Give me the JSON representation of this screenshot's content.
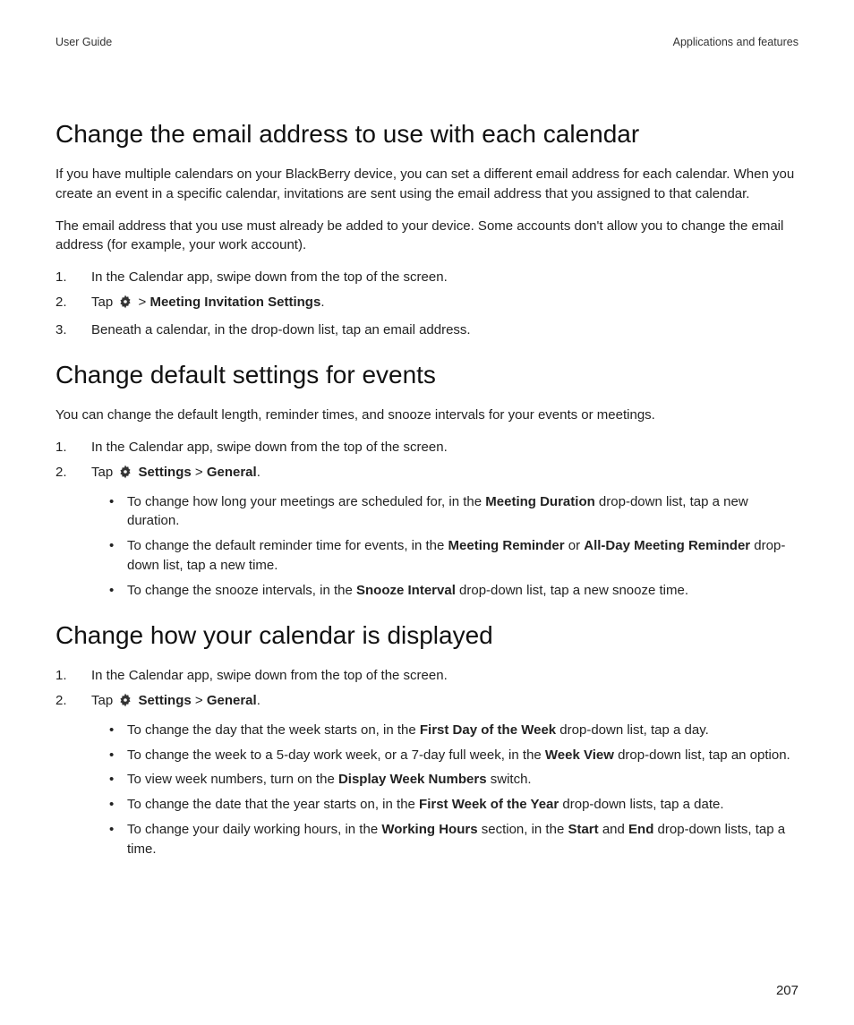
{
  "header": {
    "left": "User Guide",
    "right": "Applications and features"
  },
  "page_number": "207",
  "sec1": {
    "title": "Change the email address to use with each calendar",
    "p1": "If you have multiple calendars on your BlackBerry device, you can set a different email address for each calendar. When you create an event in a specific calendar, invitations are sent using the email address that you assigned to that calendar.",
    "p2": "The email address that you use must already be added to your device. Some accounts don't allow you to change the email address (for example, your work account).",
    "step1": "In the Calendar app, swipe down from the top of the screen.",
    "step2_pre": "Tap ",
    "step2_mid": "  > ",
    "step2_bold": "Meeting Invitation Settings",
    "step2_post": ".",
    "step3": "Beneath a calendar, in the drop-down list, tap an email address."
  },
  "sec2": {
    "title": "Change default settings for events",
    "p1": "You can change the default length, reminder times, and snooze intervals for your events or meetings.",
    "step1": "In the Calendar app, swipe down from the top of the screen.",
    "step2_pre": "Tap ",
    "step2_b1": " Settings",
    "step2_sep": " > ",
    "step2_b2": "General",
    "step2_post": ".",
    "b1_a": "To change how long your meetings are scheduled for, in the ",
    "b1_b": "Meeting Duration",
    "b1_c": " drop-down list, tap a new duration.",
    "b2_a": "To change the default reminder time for events, in the ",
    "b2_b": "Meeting Reminder",
    "b2_c": " or ",
    "b2_d": "All-Day Meeting Reminder",
    "b2_e": " drop-down list, tap a new time.",
    "b3_a": "To change the snooze intervals, in the ",
    "b3_b": "Snooze Interval",
    "b3_c": " drop-down list, tap a new snooze time."
  },
  "sec3": {
    "title": "Change how your calendar is displayed",
    "step1": "In the Calendar app, swipe down from the top of the screen.",
    "step2_pre": "Tap ",
    "step2_b1": " Settings",
    "step2_sep": " > ",
    "step2_b2": "General",
    "step2_post": ".",
    "b1_a": "To change the day that the week starts on, in the ",
    "b1_b": "First Day of the Week",
    "b1_c": " drop-down list, tap a day.",
    "b2_a": "To change the week to a 5-day work week, or a 7-day full week, in the ",
    "b2_b": "Week View",
    "b2_c": " drop-down list, tap an option.",
    "b3_a": "To view week numbers, turn on the ",
    "b3_b": "Display Week Numbers",
    "b3_c": " switch.",
    "b4_a": "To change the date that the year starts on, in the ",
    "b4_b": "First Week of the Year",
    "b4_c": " drop-down lists, tap a date.",
    "b5_a": "To change your daily working hours, in the ",
    "b5_b": "Working Hours",
    "b5_c": " section, in the ",
    "b5_d": "Start",
    "b5_e": " and ",
    "b5_f": "End",
    "b5_g": " drop-down lists, tap a time."
  }
}
